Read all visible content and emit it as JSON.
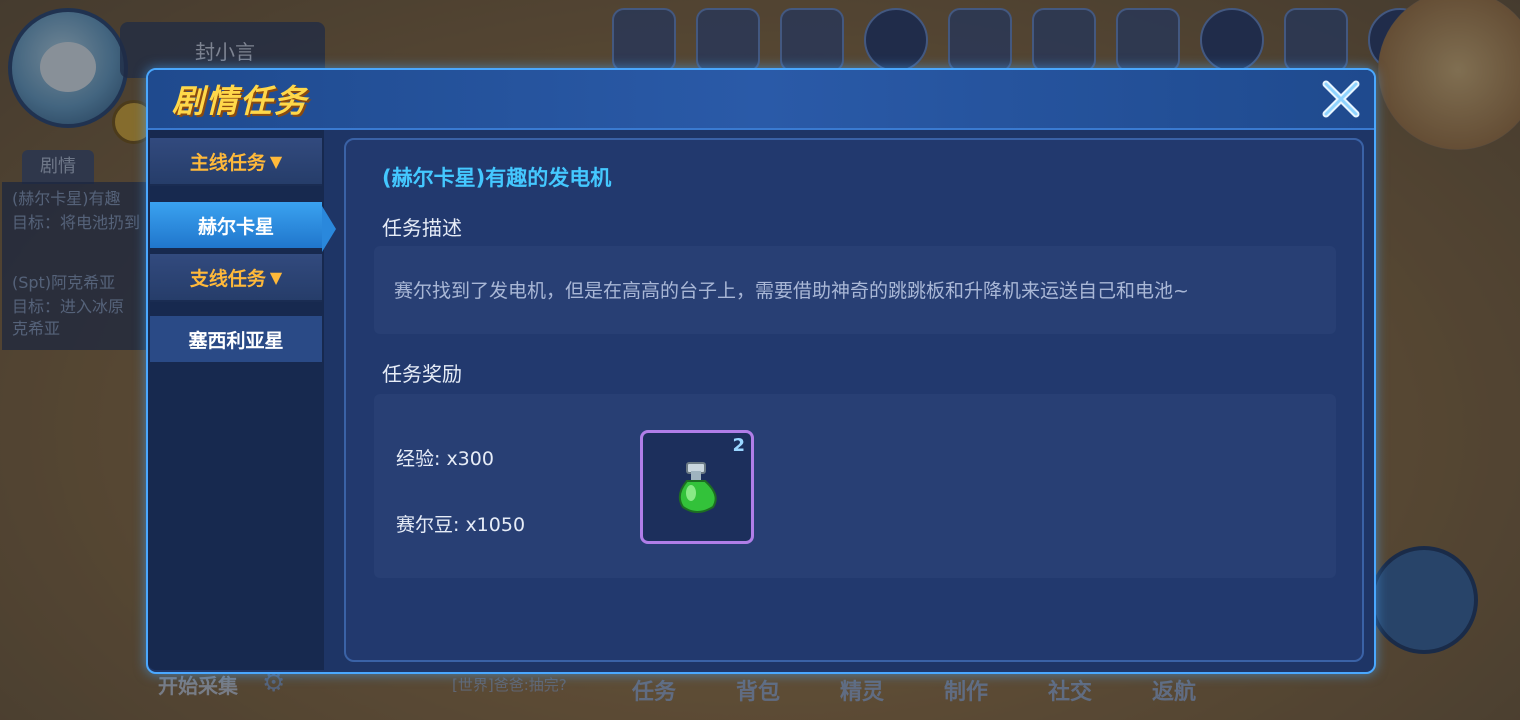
{
  "background": {
    "player_name": "封小言",
    "side_tab": "剧情",
    "side_quests": [
      {
        "title": "(赫尔卡星)有趣",
        "target": "目标：将电池扔到"
      },
      {
        "title": "(Spt)阿克希亚",
        "target": "目标：进入冰原",
        "extra": "克希亚"
      }
    ],
    "bottom_left_label": "开始采集",
    "chat_text": "[世界]爸爸:抽完?",
    "bottom_nav": [
      "任务",
      "背包",
      "精灵",
      "制作",
      "社交",
      "返航"
    ]
  },
  "modal": {
    "title": "剧情任务",
    "nav": {
      "main_section": "主线任务",
      "main_active": "赫尔卡星",
      "branch_section": "支线任务",
      "branch_item": "塞西利亚星"
    },
    "quest_title": "(赫尔卡星)有趣的发电机",
    "desc_label": "任务描述",
    "desc_text": "赛尔找到了发电机，但是在高高的台子上，需要借助神奇的跳跳板和升降机来运送自己和电池~",
    "reward_label": "任务奖励",
    "rewards": {
      "exp": "经验: x300",
      "beans": "赛尔豆: x1050",
      "item_count": "2",
      "item_icon": "green-potion-icon"
    }
  },
  "colors": {
    "title_yellow": "#ffd84a",
    "section_orange": "#ffb93a",
    "quest_title_cyan": "#44c8ff",
    "item_border_purple": "#b07ee8",
    "active_tab_blue": "#2076cc"
  }
}
